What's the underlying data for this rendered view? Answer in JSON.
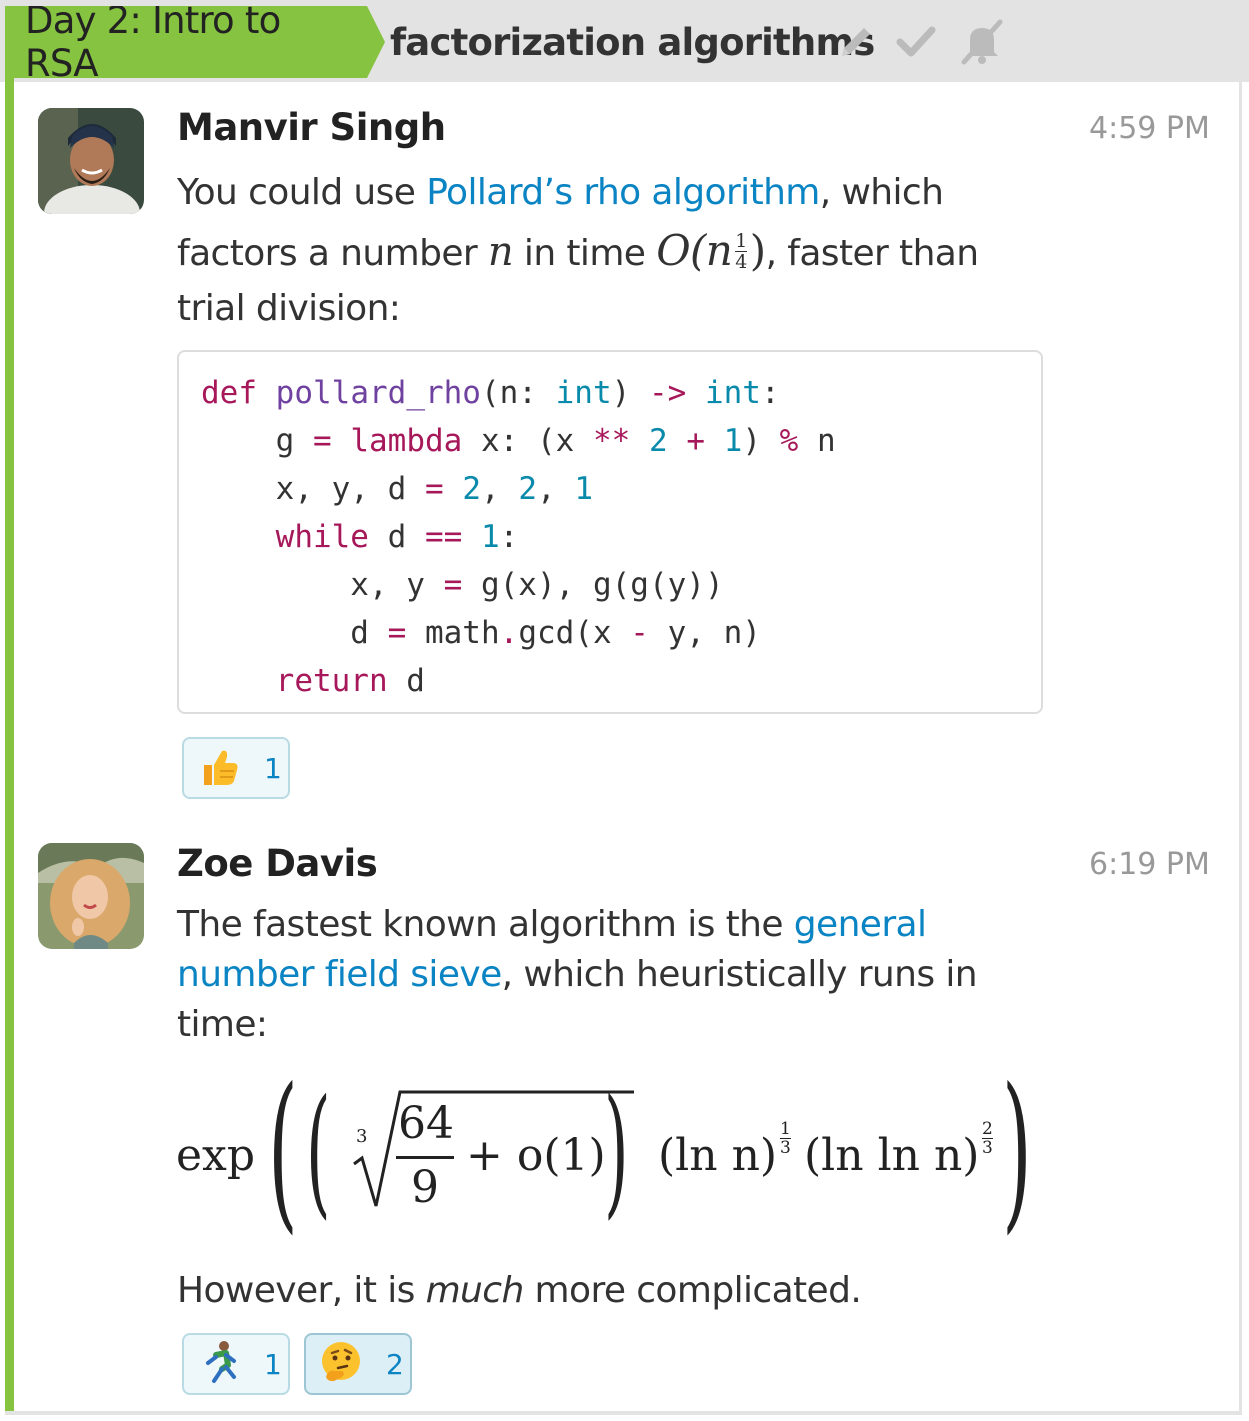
{
  "header": {
    "stream": "Day 2: Intro to RSA",
    "topic": "factorization algorithms",
    "icons": [
      "pencil-icon",
      "check-icon",
      "mute-icon"
    ]
  },
  "messages": [
    {
      "sender": "Manvir Singh",
      "time": "4:59 PM",
      "text_before": "You could use ",
      "link": "Pollard’s rho algorithm",
      "text_after_link": ", which",
      "line2_a": "factors a number ",
      "line2_var": "n",
      "line2_b": " in time ",
      "line2_math": "O(n",
      "line2_frac_num": "1",
      "line2_frac_den": "4",
      "line2_close": ")",
      "line2_c": ", faster than",
      "line3": "trial division:",
      "code": [
        "def pollard_rho(n: int) -> int:",
        "    g = lambda x: (x ** 2 + 1) % n",
        "    x, y, d = 2, 2, 1",
        "    while d == 1:",
        "        x, y = g(x), g(g(y))",
        "        d = math.gcd(x - y, n)",
        "    return d"
      ],
      "reactions": [
        {
          "emoji": "👍",
          "icon": "thumbs-up-icon",
          "count": "1"
        }
      ]
    },
    {
      "sender": "Zoe Davis",
      "time": "6:19 PM",
      "text_before": "The fastest known algorithm is the ",
      "link_line1": "general",
      "link_line2": "number field sieve",
      "text_after_link": ", which heuristically runs in",
      "line3": "time:",
      "formula": {
        "exp": "exp",
        "root_index": "3",
        "frac_num": "64",
        "frac_den": "9",
        "plus_o1": "+ o(1)",
        "ln_n": "(ln n)",
        "ln_ln_n": "(ln ln n)",
        "e1_num": "1",
        "e1_den": "3",
        "e2_num": "2",
        "e2_den": "3"
      },
      "closing_a": "However, it is ",
      "closing_em": "much",
      "closing_b": " more complicated.",
      "reactions": [
        {
          "emoji": "🏃",
          "icon": "running-person-icon",
          "count": "1"
        },
        {
          "emoji": "🤔",
          "icon": "thinking-face-icon",
          "count": "2"
        }
      ]
    }
  ],
  "colors": {
    "stream": "#86c340",
    "link": "#0b84c4",
    "keyword": "#a6185a",
    "function": "#6f42a0",
    "type": "#0a8aaa"
  }
}
